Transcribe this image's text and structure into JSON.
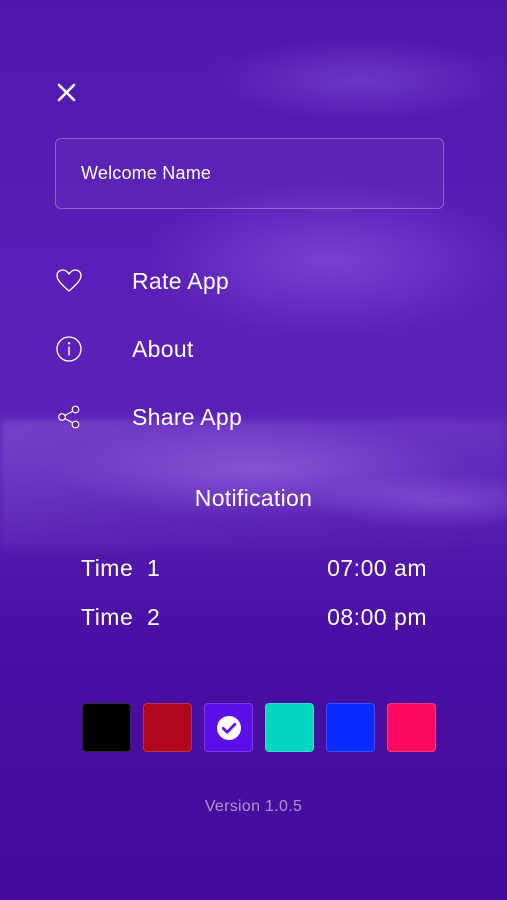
{
  "header": {
    "close_icon": "close-icon"
  },
  "name_field": {
    "value": "Welcome Name"
  },
  "menu": {
    "items": [
      {
        "label": "Rate App",
        "icon": "heart-icon"
      },
      {
        "label": "About",
        "icon": "info-icon"
      },
      {
        "label": "Share App",
        "icon": "share-icon"
      }
    ]
  },
  "notification": {
    "title": "Notification",
    "times": [
      {
        "label": "Time  1",
        "value": "07:00 am"
      },
      {
        "label": "Time  2",
        "value": "08:00 pm"
      }
    ]
  },
  "theme": {
    "colors": [
      "#000000",
      "#b0071c",
      "#5b0ee6",
      "#00d6c0",
      "#0a2bff",
      "#ff0a62"
    ],
    "selected_index": 2,
    "selected_icon": "check-circle-icon"
  },
  "footer": {
    "version": "Version 1.0.5"
  }
}
